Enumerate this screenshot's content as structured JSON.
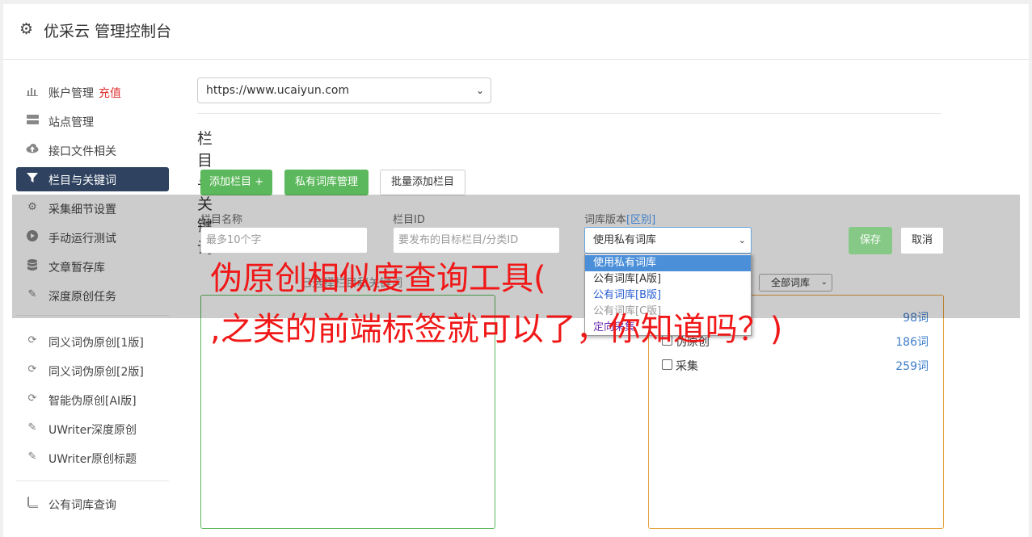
{
  "app": {
    "title": "优采云 管理控制台",
    "icon": "gear-icon"
  },
  "sidebar": {
    "items": [
      {
        "label": "账户管理",
        "icon": "bar-chart-icon",
        "badge": "充值"
      },
      {
        "label": "站点管理",
        "icon": "server-icon"
      },
      {
        "label": "接口文件相关",
        "icon": "cloud-upload-icon"
      },
      {
        "label": "栏目与关键词",
        "icon": "filter-icon",
        "active": true
      },
      {
        "label": "采集细节设置",
        "icon": "gears-icon"
      },
      {
        "label": "手动运行测试",
        "icon": "play-circle-icon"
      },
      {
        "label": "文章暂存库",
        "icon": "database-icon"
      },
      {
        "label": "深度原创任务",
        "icon": "edit-icon"
      },
      {
        "label": "同义词伪原创[1版]",
        "icon": "refresh-icon"
      },
      {
        "label": "同义词伪原创[2版]",
        "icon": "refresh-icon"
      },
      {
        "label": "智能伪原创[AI版]",
        "icon": "refresh-icon"
      },
      {
        "label": "UWriter深度原创",
        "icon": "edit-icon"
      },
      {
        "label": "UWriter原创标题",
        "icon": "edit-icon"
      },
      {
        "label": "公有词库查询",
        "icon": "book-icon"
      }
    ]
  },
  "main": {
    "site_select": "https://www.ucaiyun.com",
    "section_title": "栏目与关键词",
    "buttons": {
      "add_column": "添加栏目 +",
      "private_lib": "私有词库管理",
      "batch_add": "批量添加栏目"
    },
    "form": {
      "column_name_label": "栏目名称",
      "column_name_placeholder": "最多10个字",
      "column_id_label": "栏目ID",
      "column_id_placeholder": "要发布的目标栏目/分类ID",
      "lib_version_label": "词库版本",
      "lib_version_link": "[区别]",
      "lib_version_value": "使用私有词库",
      "save": "保存",
      "cancel": "取消"
    },
    "dropdown_options": [
      "使用私有词库",
      "公有词库[A版]",
      "公有词库[B版]",
      "公有词库[C版]",
      "定向采集"
    ],
    "hint_text": "已选择栏目和关键词",
    "lib_filter": "全部词库",
    "libraries": [
      {
        "name": "",
        "count": "98词"
      },
      {
        "name": "伪原创",
        "count": "186词"
      },
      {
        "name": "采集",
        "count": "259词"
      }
    ]
  },
  "watermark": {
    "line1": "伪原创相似度查询工具(",
    "line2": ",之类的前端标签就可以了，你知道吗？)"
  }
}
